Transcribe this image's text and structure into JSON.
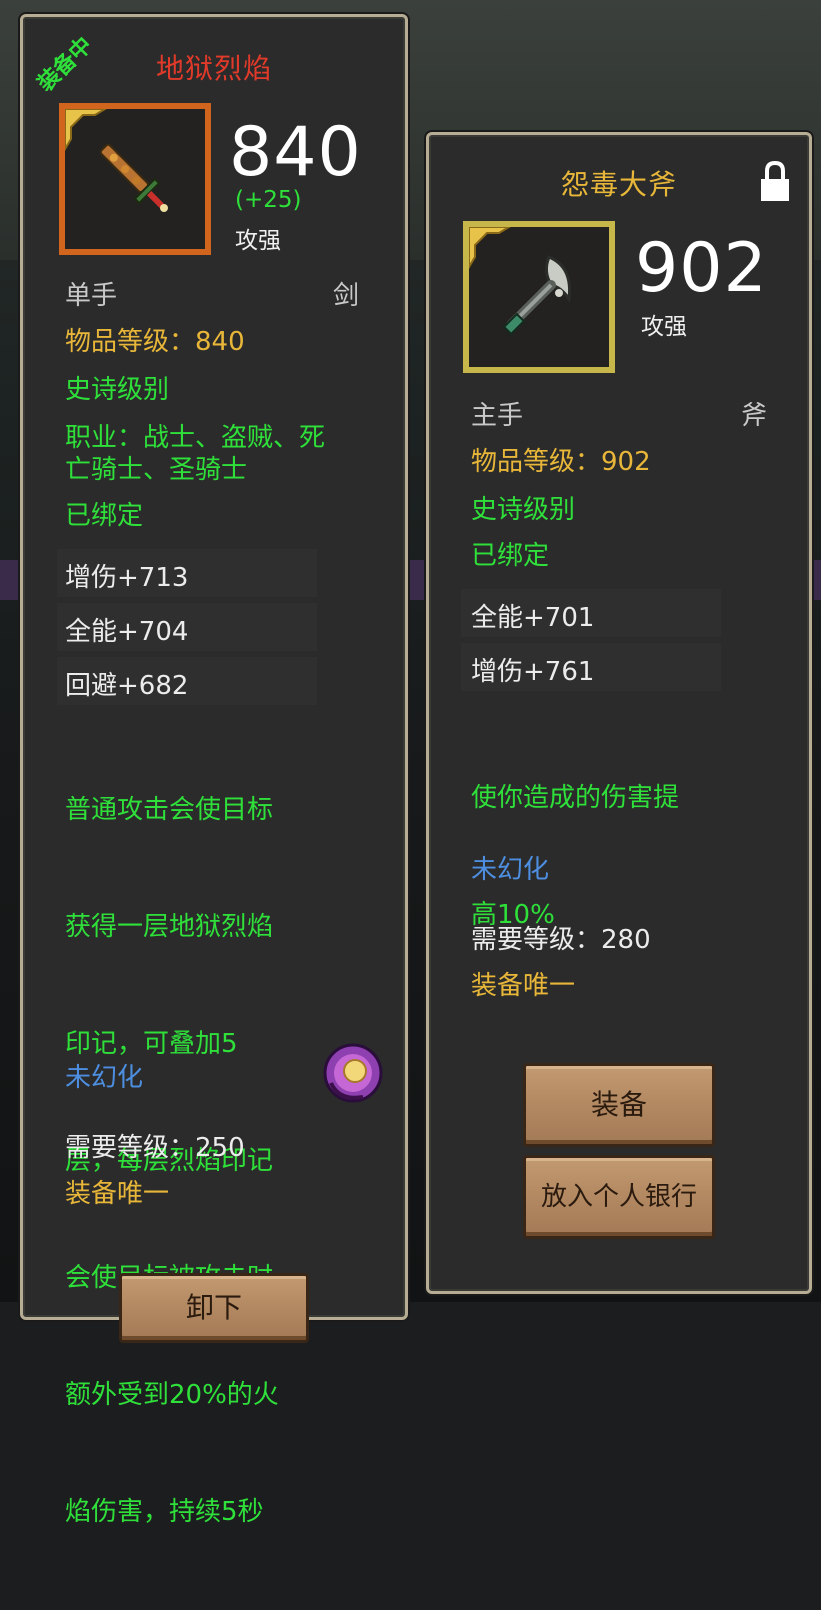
{
  "left": {
    "equipped_badge": "装备中",
    "title": "地狱烈焰",
    "title_color": "#e23a2a",
    "frame_color": "#d2651e",
    "icon": "sword-icon",
    "power": "840",
    "power_delta": "(+25)",
    "power_label": "攻强",
    "hand": "单手",
    "type": "剑",
    "item_level": "物品等级：840",
    "quality": "史诗级别",
    "class_line1": "职业：战士、盗贼、死",
    "class_line2": "亡骑士、圣骑士",
    "bound": "已绑定",
    "stats": [
      "增伤+713",
      "全能+704",
      "回避+682"
    ],
    "effect_lines": [
      "普通攻击会使目标",
      "获得一层地狱烈焰",
      "印记，可叠加5",
      "层，每层烈焰印记",
      "会使目标被攻击时",
      "额外受到20%的火",
      "焰伤害，持续5秒"
    ],
    "transmog": "未幻化",
    "transmog_icon": "transmog-orb-icon",
    "required_level": "需要等级：250",
    "unique": "装备唯一",
    "bottom_button": "卸下"
  },
  "right": {
    "title": "怨毒大斧",
    "title_color": "#e8b73a",
    "frame_color": "#c7b64a",
    "icon": "axe-icon",
    "lock_icon": "lock-icon",
    "power": "902",
    "power_label": "攻强",
    "hand": "主手",
    "type": "斧",
    "item_level": "物品等级：902",
    "quality": "史诗级别",
    "bound": "已绑定",
    "stats": [
      "全能+701",
      "增伤+761"
    ],
    "effect_lines": [
      "使你造成的伤害提",
      "高10%"
    ],
    "transmog": "未幻化",
    "required_level": "需要等级：280",
    "unique": "装备唯一",
    "equip_button": "装备",
    "bank_button": "放入个人银行"
  }
}
